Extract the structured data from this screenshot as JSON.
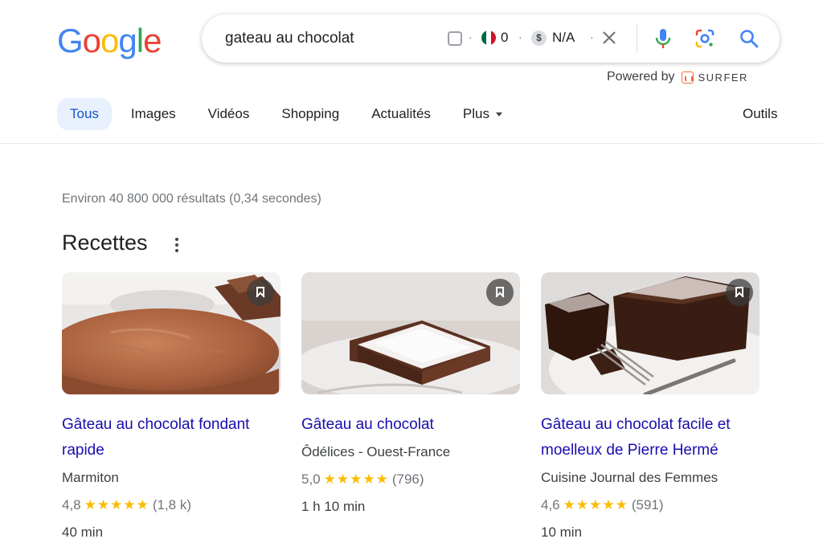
{
  "logo": {
    "letters": [
      "G",
      "o",
      "o",
      "g",
      "l",
      "e"
    ],
    "colors": [
      "#4285f4",
      "#ea4335",
      "#fbbc05",
      "#4285f4",
      "#34a853",
      "#ea4335"
    ]
  },
  "search": {
    "query": "gateau au chocolat",
    "traffic": "0",
    "cpc": "N/A",
    "dot": "·",
    "dollar_glyph": "$"
  },
  "powered_by": {
    "label": "Powered by",
    "brand": "SURFER"
  },
  "tabs": [
    {
      "label": "Tous",
      "active": true
    },
    {
      "label": "Images"
    },
    {
      "label": "Vidéos"
    },
    {
      "label": "Shopping"
    },
    {
      "label": "Actualités"
    },
    {
      "label": "Plus"
    }
  ],
  "tools_label": "Outils",
  "result_stats": "Environ 40 800 000 résultats (0,34 secondes)",
  "recipes": {
    "title": "Recettes",
    "cards": [
      {
        "title": "Gâteau au chocolat fondant rapide",
        "source": "Marmiton",
        "rating": "4,8",
        "stars": "★★★★★",
        "reviews": "(1,8 k)",
        "time": "40 min"
      },
      {
        "title": "Gâteau au chocolat",
        "source": "Ôdélices - Ouest-France",
        "rating": "5,0",
        "stars": "★★★★★",
        "reviews": "(796)",
        "time": "1 h 10 min"
      },
      {
        "title": "Gâteau au chocolat facile et moelleux de Pierre Hermé",
        "source": "Cuisine Journal des Femmes",
        "rating": "4,6",
        "stars": "★★★★★",
        "reviews": "(591)",
        "time": "10 min"
      }
    ]
  }
}
